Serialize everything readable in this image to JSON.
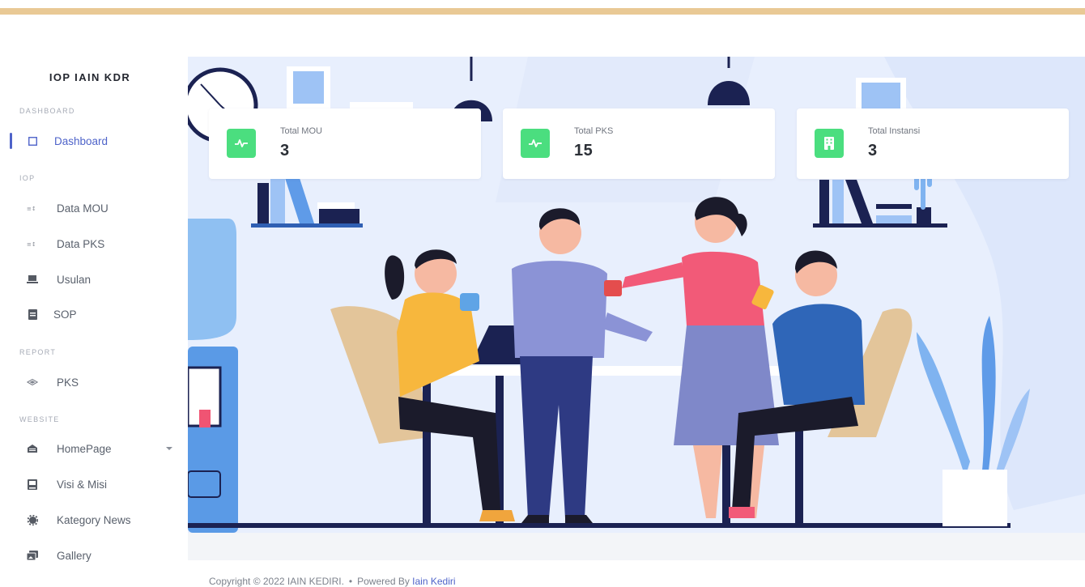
{
  "sidebar": {
    "brand": "IOP IAIN KDR",
    "sections": {
      "dashboard": "DASHBOARD",
      "iop": "IOP",
      "report": "REPORT",
      "website": "WEBSITE"
    },
    "items": [
      {
        "label": "Dashboard",
        "icon": "square-outline-icon",
        "active": true
      },
      {
        "label": "Data MOU",
        "icon": "list-icon"
      },
      {
        "label": "Data PKS",
        "icon": "list-icon"
      },
      {
        "label": "Usulan",
        "icon": "laptop-icon"
      },
      {
        "label": "SOP",
        "icon": "document-icon"
      },
      {
        "label": "PKS",
        "icon": "layers-icon"
      },
      {
        "label": "HomePage",
        "icon": "home-icon",
        "has_dropdown": true
      },
      {
        "label": "Visi & Misi",
        "icon": "book-icon"
      },
      {
        "label": "Kategory News",
        "icon": "gear-icon"
      },
      {
        "label": "Gallery",
        "icon": "image-icon"
      }
    ],
    "active_color": "#4e63c9"
  },
  "cards": [
    {
      "label": "Total MOU",
      "value": "3",
      "icon": "activity-icon"
    },
    {
      "label": "Total PKS",
      "value": "15",
      "icon": "activity-icon"
    },
    {
      "label": "Total Instansi",
      "value": "3",
      "icon": "building-icon"
    }
  ],
  "card_icon_color": "#4bde7f",
  "footer": {
    "copyright": "Copyright © 2022 IAIN KEDIRI.",
    "powered_by": "Powered By",
    "link_text": "Iain Kediri"
  },
  "colors": {
    "top_accent": "#e9c995",
    "hero_background": "#e8effd"
  }
}
